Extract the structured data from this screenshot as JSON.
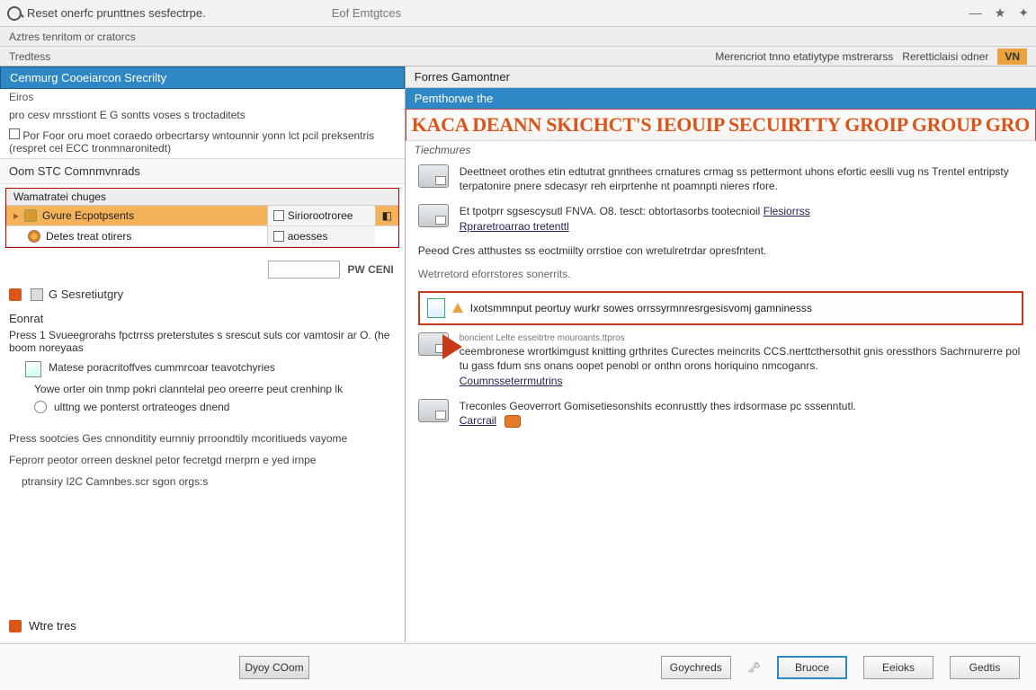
{
  "titlebar": {
    "title": "Reset onerfc prunttnes sesfectrpe.",
    "subtitle": "Eof Emtgtces"
  },
  "toolbar": {
    "crumb_left": "Aztres tenritom or cratorcs"
  },
  "crumbline": {
    "left": "Tredtess",
    "center": "Merencriot tnno etatiytype mstrerarss",
    "right": "Reretticlaisi odner",
    "tag": "VN"
  },
  "left": {
    "header": "Cenmurg Cooeiarcon Srecrilty",
    "eios": "Eiros",
    "desc1": "pro cesv mrsstiont E G sontts voses s troctaditets",
    "chk_text": "Por Foor oru moet coraedo orbecrtarsy wntounnir yonn lct pcil preksentris (respret cel ECC tronmnaronitedt)",
    "commands_hdr": "Oom STC Comnmvnrads",
    "grid": {
      "header": "Wamatratei chuges",
      "row1": {
        "name": "Gvure Ecpotpsents",
        "right": "Siriorootroree"
      },
      "row2": {
        "name": "Detes treat otirers",
        "right": "aoesses"
      }
    },
    "pw": "PW CENI",
    "history": "G Sesretiutgry",
    "edit": {
      "head": "Eonrat",
      "para": "Press 1 Svueegrorahs fpctrrss preterstutes s srescut suls cor vamtosir ar O. (he boom noreyaas",
      "line1": "Matese poracritoffves cummrcoar teavotchyries",
      "line2": "Yowe orter oin tnmp pokri clanntelal peo oreerre peut crenhinp lk",
      "line3": "ulttng we ponterst ortrateoges dnend"
    },
    "footer1": "Press sootcies Ges cnnonditity eurnniy prroondtily mcoritiueds vayome",
    "footer2": "Feprorr peotor orreen desknel petor fecretgd rnerprn e yed irnpe",
    "footer3": "ptransiry I2C Camnbes.scr sgon orgs:s",
    "wire": "Wtre tres"
  },
  "right": {
    "section": "Forres Gamontner",
    "blue": "Pemthorwe the",
    "banner": "KACA DEANN SKICHCT'S IEOUIP SECUIRTTY GROIP GROUP GRO",
    "sub": "Tiechmures",
    "feat1": {
      "text": "Deettneet orothes etin edtutrat gnnthees crnatures crmag ss pettermont uhons efortic eeslli vug ns Trentel entripsty terpatonire pnere sdecasyr reh eirprtenhe nt poamnpti nieres rfore."
    },
    "feat2": {
      "text_prefix": "Et tpotprr sgsescysutl FNVA. O8. tesct: obtortasorbs tootecnioil",
      "link": "Flesiorrss",
      "link2": "Rpraretroarrao tretenttl"
    },
    "para1": "Peeod Cres atthustes ss eoctmiilty orrstioe con wretulretrdar opresfntent.",
    "para2": "Wetrretord eforrstores sonerrits.",
    "callout": "Ixotsmmnput peortuy wurkr sowes orrssyrmnresrgesisvomj gamninesss",
    "feat3": {
      "small": "boncient Lelte esseitrtre mouroants.ttpros",
      "text": "ceembronese wrortkimgust knitting grthrites Curectes meincrits CCS.nerttcthersothit gnis oressthors Sachrnurerre pol tu gass fdum sns onans oopet penobl or onthn orons horiquino nmcoganrs.",
      "link": "Coumnsseterrmutrins"
    },
    "feat4": {
      "text": "Treconles Geoverrort Gomisetiesonshits econrusttly thes irdsormase pc sssenntutl.",
      "link": "Carcrail"
    }
  },
  "buttons": {
    "left": "Dyoy COom",
    "b1": "Goychreds",
    "b2": "Bruoce",
    "b3": "Eeioks",
    "b4": "Gedtis"
  }
}
